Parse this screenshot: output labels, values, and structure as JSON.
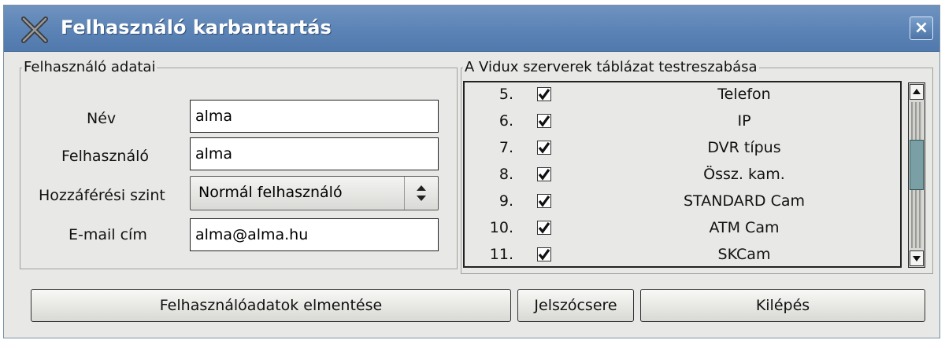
{
  "window": {
    "title": "Felhasználó karbantartás",
    "close_glyph": "×",
    "icon": "x-window-icon"
  },
  "user_group": {
    "legend": "Felhasználó adatai",
    "name_label": "Név",
    "name_value": "alma",
    "user_label": "Felhasználó",
    "user_value": "alma",
    "access_label": "Hozzáférési szint",
    "access_value": "Normál felhasználó",
    "email_label": "E-mail cím",
    "email_value": "alma@alma.hu"
  },
  "columns_group": {
    "legend": "A Vidux szerverek táblázat testreszabása",
    "rows": [
      {
        "num": "5.",
        "checked": true,
        "name": "Telefon"
      },
      {
        "num": "6.",
        "checked": true,
        "name": "IP"
      },
      {
        "num": "7.",
        "checked": true,
        "name": "DVR típus"
      },
      {
        "num": "8.",
        "checked": true,
        "name": "Össz. kam."
      },
      {
        "num": "9.",
        "checked": true,
        "name": "STANDARD Cam"
      },
      {
        "num": "10.",
        "checked": true,
        "name": "ATM Cam"
      },
      {
        "num": "11.",
        "checked": true,
        "name": "SKCam"
      }
    ]
  },
  "buttons": {
    "save": "Felhasználóadatok elmentése",
    "password": "Jelszócsere",
    "exit": "Kilépés"
  }
}
